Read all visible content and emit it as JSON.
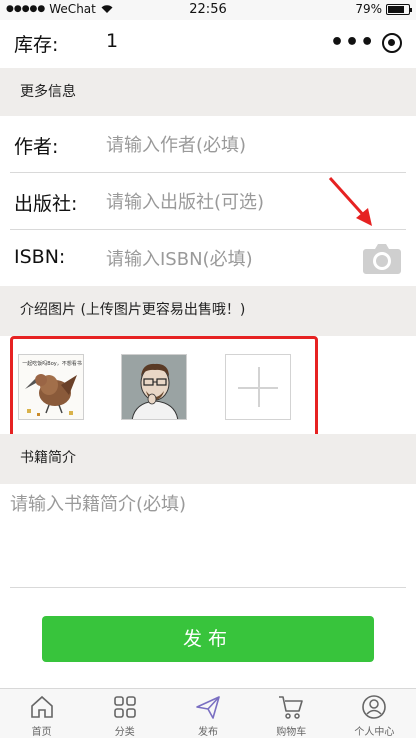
{
  "status_bar": {
    "signal": "●●●●●",
    "carrier": "WeChat",
    "time": "22:56",
    "battery": "79%",
    "battery_level": 0.79
  },
  "stock": {
    "label": "库存:",
    "value": "1"
  },
  "capsule": {
    "more": "•••"
  },
  "sections": {
    "more_info": "更多信息",
    "images": "介绍图片 (上传图片更容易出售哦！)",
    "intro": "书籍简介"
  },
  "fields": {
    "author": {
      "label": "作者:",
      "placeholder": "请输入作者(必填)"
    },
    "publisher": {
      "label": "出版社:",
      "placeholder": "请输入出版社(可选)"
    },
    "isbn": {
      "label": "ISBN:",
      "placeholder": "请输入ISBN(必填)"
    }
  },
  "images": {
    "thumb1_caption": "一起吃饭吗Boy，不想看书"
  },
  "intro": {
    "placeholder": "请输入书籍简介(必填)"
  },
  "publish_button": "发布",
  "tabbar": {
    "items": [
      {
        "label": "首页",
        "icon": "home-icon"
      },
      {
        "label": "分类",
        "icon": "grid-icon"
      },
      {
        "label": "发布",
        "icon": "send-icon",
        "active": true
      },
      {
        "label": "购物车",
        "icon": "cart-icon"
      },
      {
        "label": "个人中心",
        "icon": "user-icon"
      }
    ]
  },
  "colors": {
    "accent_green": "#38c43c",
    "highlight_red": "#e62222",
    "section_bg": "#efedeb",
    "active_tab": "#7a6fc2"
  }
}
